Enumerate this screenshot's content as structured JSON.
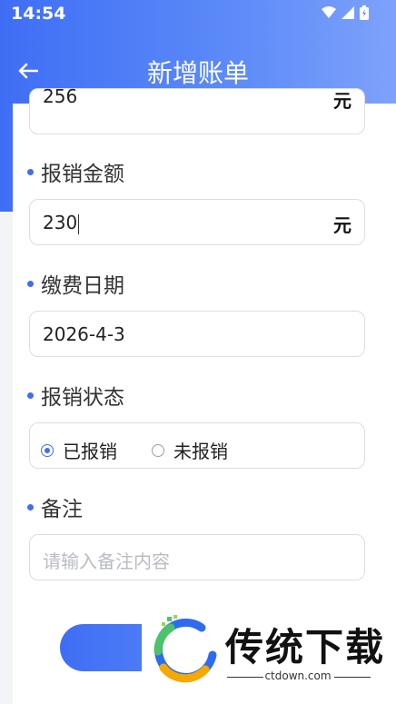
{
  "status_bar": {
    "time": "14:54"
  },
  "header": {
    "title": "新增账单"
  },
  "fields": {
    "amount": {
      "value": "256",
      "unit": "元"
    },
    "reimburse_amount": {
      "label": "报销金额",
      "value": "230",
      "unit": "元"
    },
    "pay_date": {
      "label": "缴费日期",
      "value": "2026-4-3"
    },
    "reimburse_status": {
      "label": "报销状态",
      "options": [
        {
          "label": "已报销",
          "checked": true
        },
        {
          "label": "未报销",
          "checked": false
        }
      ]
    },
    "remark": {
      "label": "备注",
      "placeholder": "请输入备注内容"
    }
  },
  "colors": {
    "accent": "#3f6ef5",
    "header_end": "#7ea2fb"
  },
  "watermark": {
    "brand": "传统下载",
    "url": "ctdown.com"
  }
}
